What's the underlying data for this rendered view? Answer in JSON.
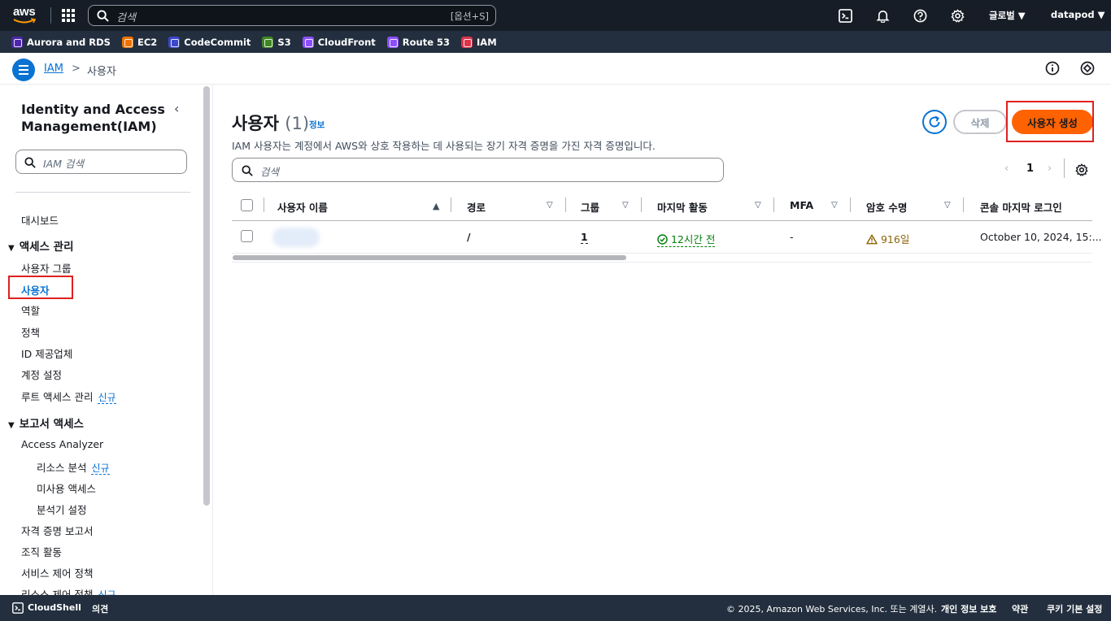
{
  "topnav": {
    "search_placeholder": "검색",
    "search_shortcut": "[옵션+S]",
    "region": "글로벌",
    "account": "datapod"
  },
  "favorites": [
    {
      "label": "Aurora and RDS",
      "color": "#4d27aa"
    },
    {
      "label": "EC2",
      "color": "#ed7100"
    },
    {
      "label": "CodeCommit",
      "color": "#3b48cc"
    },
    {
      "label": "S3",
      "color": "#3f8624"
    },
    {
      "label": "CloudFront",
      "color": "#8c4fff"
    },
    {
      "label": "Route 53",
      "color": "#8c4fff"
    },
    {
      "label": "IAM",
      "color": "#dd344c"
    }
  ],
  "breadcrumb": {
    "root": "IAM",
    "separator": ">",
    "current": "사용자"
  },
  "sidebar": {
    "title": "Identity and Access Management(IAM)",
    "search_placeholder": "IAM 검색",
    "dashboard": "대시보드",
    "access_mgmt": "액세스 관리",
    "user_groups": "사용자 그룹",
    "users": "사용자",
    "roles": "역할",
    "policies": "정책",
    "id_providers": "ID 제공업체",
    "account_settings": "계정 설정",
    "root_access": "루트 액세스 관리",
    "new_tag": "신규",
    "reports_access": "보고서 액세스",
    "access_analyzer": "Access Analyzer",
    "resource_analysis": "리소스 분석",
    "unused_access": "미사용 액세스",
    "analyzer_settings": "분석기 설정",
    "credential_report": "자격 증명 보고서",
    "org_activity": "조직 활동",
    "scp": "서비스 제어 정책",
    "rcp": "리소스 제어 정책"
  },
  "main": {
    "title": "사용자",
    "count": "(1)",
    "info": "정보",
    "description": "IAM 사용자는 계정에서 AWS와 상호 작용하는 데 사용되는 장기 자격 증명을 가진 자격 증명입니다.",
    "delete_label": "삭제",
    "create_label": "사용자 생성",
    "search_placeholder": "검색",
    "page": "1",
    "columns": {
      "username": "사용자 이름",
      "path": "경로",
      "groups": "그룹",
      "last_activity": "마지막 활동",
      "mfa": "MFA",
      "password_age": "암호 수명",
      "console_last_login": "콘솔 마지막 로그인"
    },
    "rows": [
      {
        "path": "/",
        "groups": "1",
        "last_activity": "12시간 전",
        "mfa": "-",
        "password_age": "916일",
        "console_last_login": "October 10, 2024, 15:..."
      }
    ]
  },
  "footer": {
    "cloudshell": "CloudShell",
    "feedback": "의견",
    "copyright": "© 2025, Amazon Web Services, Inc. 또는 계열사.",
    "privacy": "개인 정보 보호",
    "terms": "약관",
    "cookies": "쿠키 기본 설정"
  },
  "colors": {
    "accent": "#0972d3",
    "primary_button": "#ff6200",
    "success": "#037f0c",
    "warning": "#8d6605",
    "highlight": "#e02020"
  },
  "icons": [
    "aws-logo",
    "apps-grid-icon",
    "search-icon",
    "cloudshell-icon",
    "bell-icon",
    "help-icon",
    "gear-icon",
    "info-icon",
    "notifications-icon",
    "refresh-icon",
    "success-icon",
    "warning-icon",
    "chevron-left-icon",
    "chevron-right-icon"
  ]
}
